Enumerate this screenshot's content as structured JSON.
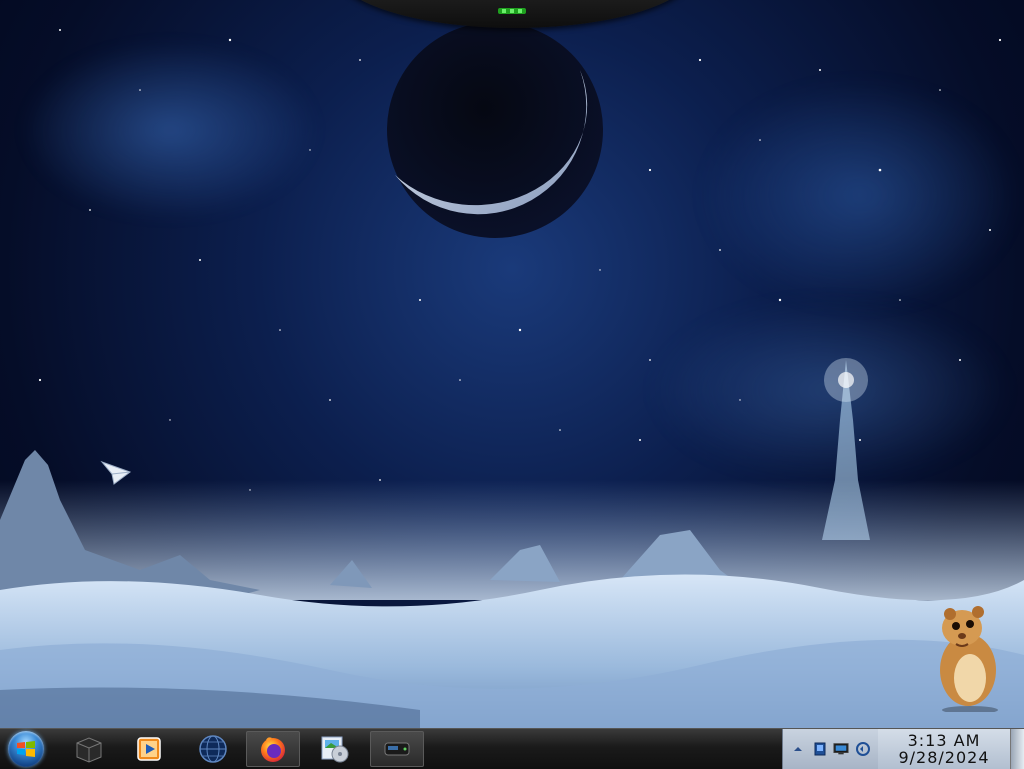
{
  "desktop": {
    "wallpaper": "space-planet-ice-landscape"
  },
  "taskbar": {
    "start_button": {
      "icon": "windows-logo-icon"
    },
    "pinned": [
      {
        "name": "box-app-icon"
      },
      {
        "name": "media-player-icon"
      },
      {
        "name": "globe-icon"
      },
      {
        "name": "firefox-icon"
      },
      {
        "name": "media-gallery-icon"
      },
      {
        "name": "drive-icon"
      }
    ],
    "tray": {
      "icons": [
        "show-hidden-icons-arrow-icon",
        "action-center-flag-icon",
        "network-monitor-icon",
        "volume-icon"
      ]
    },
    "clock": {
      "time": "3:13 AM",
      "date": "9/28/2024"
    }
  },
  "colors": {
    "taskbar": "#1a1a1a",
    "tray_background": "#b8c4d4",
    "sky": "#0c1f4e",
    "accent_green": "#2ed82e"
  }
}
